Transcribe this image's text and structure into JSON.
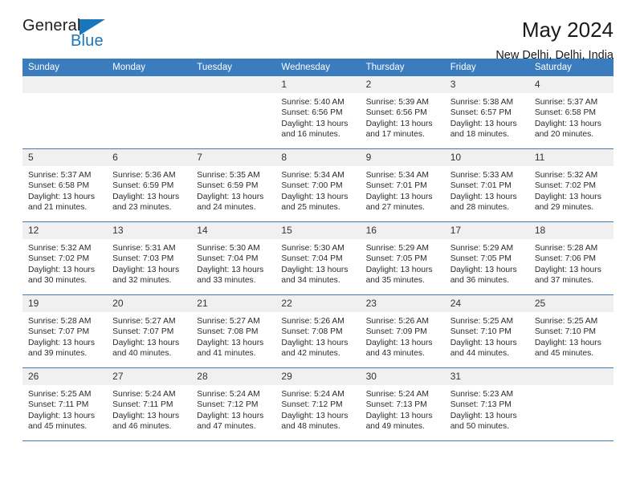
{
  "brand": {
    "name_top": "General",
    "name_bottom": "Blue",
    "triangle_icon": "triangle-icon",
    "accent_color": "#1b75bb"
  },
  "header": {
    "title": "May 2024",
    "subtitle": "New Delhi, Delhi, India"
  },
  "colors": {
    "header_row_bg": "#3b7cbe",
    "daynum_bg": "#f0f0f0",
    "text": "#222222"
  },
  "calendar": {
    "weekdays": [
      "Sunday",
      "Monday",
      "Tuesday",
      "Wednesday",
      "Thursday",
      "Friday",
      "Saturday"
    ],
    "weeks": [
      [
        {
          "day": "",
          "empty": true
        },
        {
          "day": "",
          "empty": true
        },
        {
          "day": "",
          "empty": true
        },
        {
          "day": "1",
          "sunrise": "Sunrise: 5:40 AM",
          "sunset": "Sunset: 6:56 PM",
          "daylight1": "Daylight: 13 hours",
          "daylight2": "and 16 minutes."
        },
        {
          "day": "2",
          "sunrise": "Sunrise: 5:39 AM",
          "sunset": "Sunset: 6:56 PM",
          "daylight1": "Daylight: 13 hours",
          "daylight2": "and 17 minutes."
        },
        {
          "day": "3",
          "sunrise": "Sunrise: 5:38 AM",
          "sunset": "Sunset: 6:57 PM",
          "daylight1": "Daylight: 13 hours",
          "daylight2": "and 18 minutes."
        },
        {
          "day": "4",
          "sunrise": "Sunrise: 5:37 AM",
          "sunset": "Sunset: 6:58 PM",
          "daylight1": "Daylight: 13 hours",
          "daylight2": "and 20 minutes."
        }
      ],
      [
        {
          "day": "5",
          "sunrise": "Sunrise: 5:37 AM",
          "sunset": "Sunset: 6:58 PM",
          "daylight1": "Daylight: 13 hours",
          "daylight2": "and 21 minutes."
        },
        {
          "day": "6",
          "sunrise": "Sunrise: 5:36 AM",
          "sunset": "Sunset: 6:59 PM",
          "daylight1": "Daylight: 13 hours",
          "daylight2": "and 23 minutes."
        },
        {
          "day": "7",
          "sunrise": "Sunrise: 5:35 AM",
          "sunset": "Sunset: 6:59 PM",
          "daylight1": "Daylight: 13 hours",
          "daylight2": "and 24 minutes."
        },
        {
          "day": "8",
          "sunrise": "Sunrise: 5:34 AM",
          "sunset": "Sunset: 7:00 PM",
          "daylight1": "Daylight: 13 hours",
          "daylight2": "and 25 minutes."
        },
        {
          "day": "9",
          "sunrise": "Sunrise: 5:34 AM",
          "sunset": "Sunset: 7:01 PM",
          "daylight1": "Daylight: 13 hours",
          "daylight2": "and 27 minutes."
        },
        {
          "day": "10",
          "sunrise": "Sunrise: 5:33 AM",
          "sunset": "Sunset: 7:01 PM",
          "daylight1": "Daylight: 13 hours",
          "daylight2": "and 28 minutes."
        },
        {
          "day": "11",
          "sunrise": "Sunrise: 5:32 AM",
          "sunset": "Sunset: 7:02 PM",
          "daylight1": "Daylight: 13 hours",
          "daylight2": "and 29 minutes."
        }
      ],
      [
        {
          "day": "12",
          "sunrise": "Sunrise: 5:32 AM",
          "sunset": "Sunset: 7:02 PM",
          "daylight1": "Daylight: 13 hours",
          "daylight2": "and 30 minutes."
        },
        {
          "day": "13",
          "sunrise": "Sunrise: 5:31 AM",
          "sunset": "Sunset: 7:03 PM",
          "daylight1": "Daylight: 13 hours",
          "daylight2": "and 32 minutes."
        },
        {
          "day": "14",
          "sunrise": "Sunrise: 5:30 AM",
          "sunset": "Sunset: 7:04 PM",
          "daylight1": "Daylight: 13 hours",
          "daylight2": "and 33 minutes."
        },
        {
          "day": "15",
          "sunrise": "Sunrise: 5:30 AM",
          "sunset": "Sunset: 7:04 PM",
          "daylight1": "Daylight: 13 hours",
          "daylight2": "and 34 minutes."
        },
        {
          "day": "16",
          "sunrise": "Sunrise: 5:29 AM",
          "sunset": "Sunset: 7:05 PM",
          "daylight1": "Daylight: 13 hours",
          "daylight2": "and 35 minutes."
        },
        {
          "day": "17",
          "sunrise": "Sunrise: 5:29 AM",
          "sunset": "Sunset: 7:05 PM",
          "daylight1": "Daylight: 13 hours",
          "daylight2": "and 36 minutes."
        },
        {
          "day": "18",
          "sunrise": "Sunrise: 5:28 AM",
          "sunset": "Sunset: 7:06 PM",
          "daylight1": "Daylight: 13 hours",
          "daylight2": "and 37 minutes."
        }
      ],
      [
        {
          "day": "19",
          "sunrise": "Sunrise: 5:28 AM",
          "sunset": "Sunset: 7:07 PM",
          "daylight1": "Daylight: 13 hours",
          "daylight2": "and 39 minutes."
        },
        {
          "day": "20",
          "sunrise": "Sunrise: 5:27 AM",
          "sunset": "Sunset: 7:07 PM",
          "daylight1": "Daylight: 13 hours",
          "daylight2": "and 40 minutes."
        },
        {
          "day": "21",
          "sunrise": "Sunrise: 5:27 AM",
          "sunset": "Sunset: 7:08 PM",
          "daylight1": "Daylight: 13 hours",
          "daylight2": "and 41 minutes."
        },
        {
          "day": "22",
          "sunrise": "Sunrise: 5:26 AM",
          "sunset": "Sunset: 7:08 PM",
          "daylight1": "Daylight: 13 hours",
          "daylight2": "and 42 minutes."
        },
        {
          "day": "23",
          "sunrise": "Sunrise: 5:26 AM",
          "sunset": "Sunset: 7:09 PM",
          "daylight1": "Daylight: 13 hours",
          "daylight2": "and 43 minutes."
        },
        {
          "day": "24",
          "sunrise": "Sunrise: 5:25 AM",
          "sunset": "Sunset: 7:10 PM",
          "daylight1": "Daylight: 13 hours",
          "daylight2": "and 44 minutes."
        },
        {
          "day": "25",
          "sunrise": "Sunrise: 5:25 AM",
          "sunset": "Sunset: 7:10 PM",
          "daylight1": "Daylight: 13 hours",
          "daylight2": "and 45 minutes."
        }
      ],
      [
        {
          "day": "26",
          "sunrise": "Sunrise: 5:25 AM",
          "sunset": "Sunset: 7:11 PM",
          "daylight1": "Daylight: 13 hours",
          "daylight2": "and 45 minutes."
        },
        {
          "day": "27",
          "sunrise": "Sunrise: 5:24 AM",
          "sunset": "Sunset: 7:11 PM",
          "daylight1": "Daylight: 13 hours",
          "daylight2": "and 46 minutes."
        },
        {
          "day": "28",
          "sunrise": "Sunrise: 5:24 AM",
          "sunset": "Sunset: 7:12 PM",
          "daylight1": "Daylight: 13 hours",
          "daylight2": "and 47 minutes."
        },
        {
          "day": "29",
          "sunrise": "Sunrise: 5:24 AM",
          "sunset": "Sunset: 7:12 PM",
          "daylight1": "Daylight: 13 hours",
          "daylight2": "and 48 minutes."
        },
        {
          "day": "30",
          "sunrise": "Sunrise: 5:24 AM",
          "sunset": "Sunset: 7:13 PM",
          "daylight1": "Daylight: 13 hours",
          "daylight2": "and 49 minutes."
        },
        {
          "day": "31",
          "sunrise": "Sunrise: 5:23 AM",
          "sunset": "Sunset: 7:13 PM",
          "daylight1": "Daylight: 13 hours",
          "daylight2": "and 50 minutes."
        },
        {
          "day": "",
          "empty": true
        }
      ]
    ]
  }
}
